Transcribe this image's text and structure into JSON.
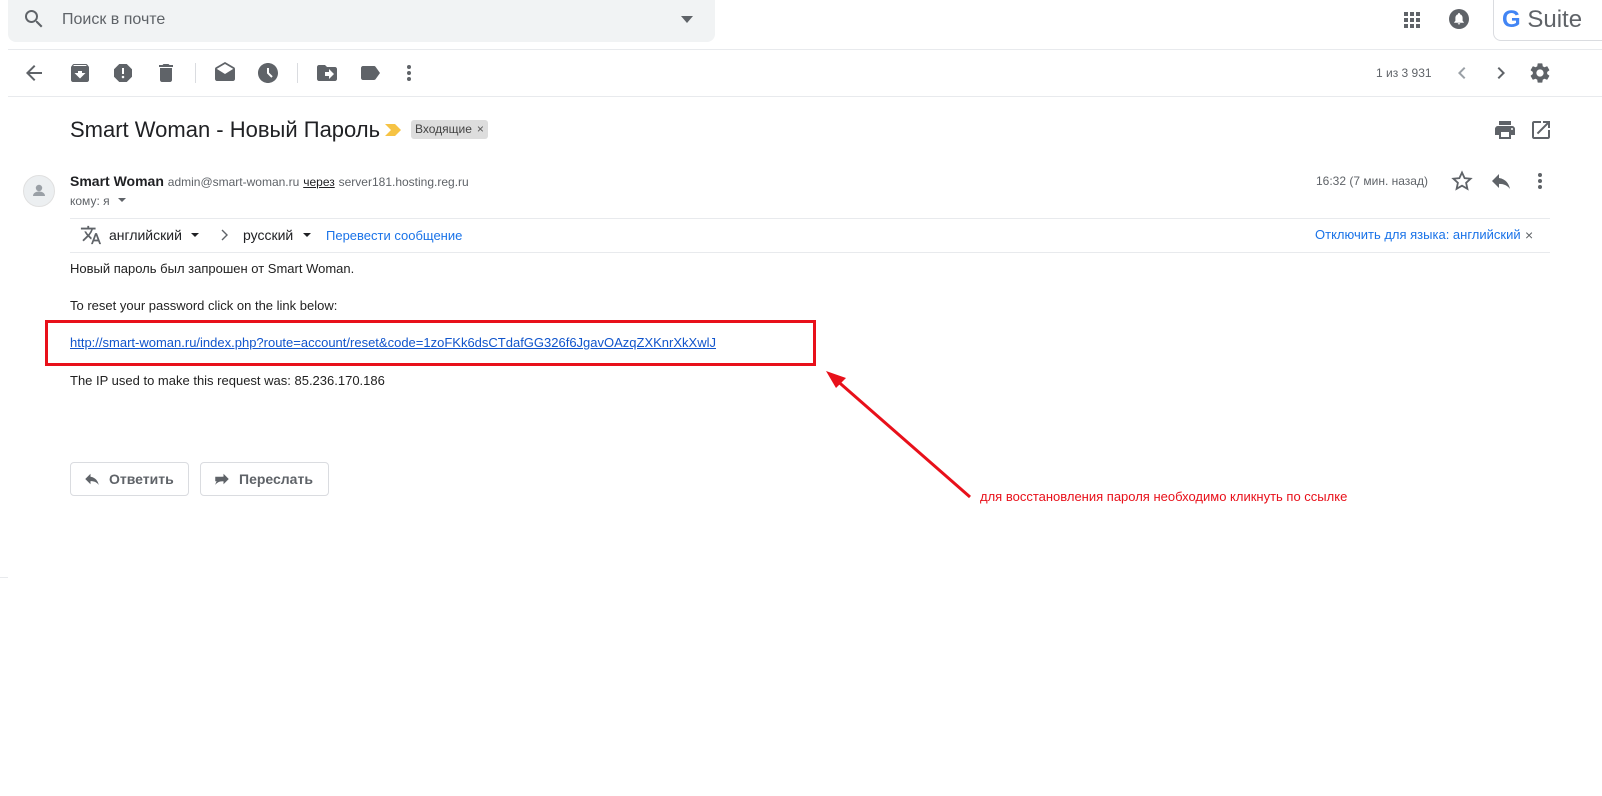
{
  "search": {
    "placeholder": "Поиск в почте"
  },
  "header": {
    "gsuite_g": "G",
    "gsuite_text": " Suite"
  },
  "toolbar": {
    "page_counter": "1 из 3 931"
  },
  "message": {
    "subject": "Smart Woman - Новый Пароль",
    "label": "Входящие",
    "label_remove": "×",
    "sender_name": "Smart Woman",
    "sender_email": "admin@smart-woman.ru",
    "via_word": "через",
    "via_server": "server181.hosting.reg.ru",
    "to_line": "кому: я",
    "time": "16:32 (7 мин. назад)"
  },
  "translate": {
    "from_lang": "английский",
    "to_lang": "русский",
    "translate_link": "Перевести сообщение",
    "disable_link": "Отключить для языка: английский",
    "close": "×"
  },
  "body": {
    "line1": "Новый пароль был запрошен от Smart Woman.",
    "line2": "To reset your password click on the link below:",
    "link": "http://smart-woman.ru/index.php?route=account/reset&code=1zoFKk6dsCTdafGG326f6JgavOAzqZXKnrXkXwlJ",
    "line3": "The IP used to make this request was: 85.236.170.186"
  },
  "actions": {
    "reply": "Ответить",
    "forward": "Переслать"
  },
  "annotation": {
    "text": "для восстановления пароля необходимо кликнуть по ссылке",
    "color": "#e8101a"
  },
  "icons": [
    "search-icon",
    "caret-down-icon",
    "apps-grid-icon",
    "notification-bell-icon",
    "back-arrow-icon",
    "archive-icon",
    "report-spam-icon",
    "delete-icon",
    "mark-unread-icon",
    "snooze-icon",
    "move-to-icon",
    "label-icon",
    "more-vert-icon",
    "chevron-left-icon",
    "chevron-right-icon",
    "gear-icon",
    "print-icon",
    "open-new-window-icon",
    "star-icon",
    "reply-icon",
    "translate-icon",
    "chevron-right-icon"
  ]
}
